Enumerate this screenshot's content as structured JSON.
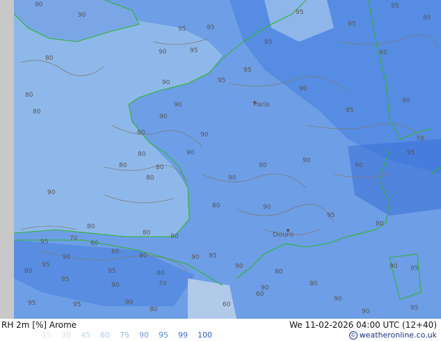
{
  "legend": {
    "title": "RH 2m [%] Arome",
    "valid": "We 11-02-2026 04:00 UTC (12+40)",
    "credit": "weatheronline.co.uk",
    "scale": [
      {
        "value": "15",
        "color": "#d9e4ee"
      },
      {
        "value": "30",
        "color": "#d0dcea"
      },
      {
        "value": "45",
        "color": "#c2d4ea"
      },
      {
        "value": "60",
        "color": "#a8c8f0"
      },
      {
        "value": "75",
        "color": "#8fb8ea"
      },
      {
        "value": "90",
        "color": "#6e9ee6"
      },
      {
        "value": "95",
        "color": "#4f86e0"
      },
      {
        "value": "99",
        "color": "#3a6fd6"
      },
      {
        "value": "100",
        "color": "#2a58c8"
      }
    ]
  },
  "cities": [
    "Paris",
    "Douro"
  ],
  "contour_labels": [
    "80",
    "90",
    "95",
    "80",
    "90",
    "95",
    "80",
    "90",
    "95",
    "80",
    "90",
    "95",
    "80",
    "90",
    "95",
    "70",
    "60",
    "90",
    "95",
    "80",
    "90",
    "95",
    "80",
    "90",
    "95",
    "80",
    "90",
    "95",
    "80",
    "90",
    "95",
    "80",
    "90",
    "95",
    "80",
    "90",
    "95",
    "80",
    "90",
    "95",
    "80",
    "90"
  ],
  "colors": {
    "land": "#6e9ee6",
    "sea": "#8fb8ea",
    "humid": "#4f86e0",
    "dry": "#a8c8f0",
    "coast": "#2fb52f",
    "contour": "#7c7c7c",
    "frame": "#c8c8c8"
  }
}
